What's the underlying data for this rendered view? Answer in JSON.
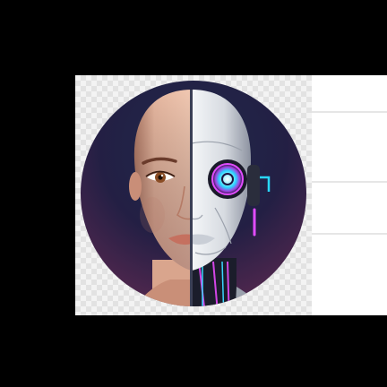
{
  "image": {
    "subject": "half-human-half-robot-face",
    "background": "#000000",
    "circle_gradient": [
      "#15203b",
      "#2b2148",
      "#5a2858"
    ],
    "accent_colors": {
      "cyan": "#29d7ff",
      "magenta": "#e14cff",
      "skin": "#e0b29c",
      "robot_white": "#e7eaee"
    }
  }
}
